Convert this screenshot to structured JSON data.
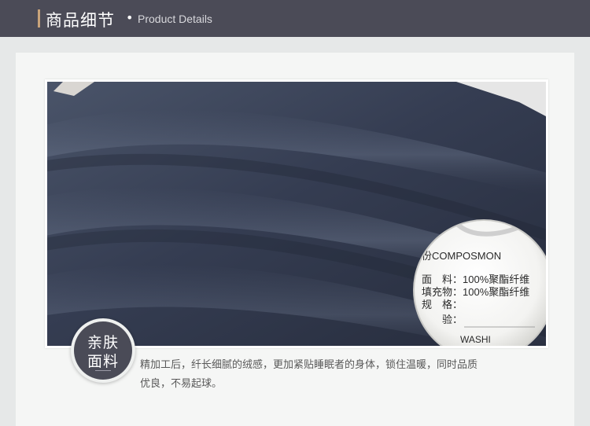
{
  "header": {
    "title_cn": "商品细节",
    "separator": "•",
    "title_en": "Product Details"
  },
  "photo": {
    "label": {
      "line1": "份COMPOSMON",
      "line2": "面　料：100%聚酯纤维",
      "line3": "填充物：100%聚酯纤维",
      "line4": "规　格：",
      "line5": "　　验：",
      "line6": "WASHI"
    }
  },
  "badge": {
    "line1": "亲肤",
    "line2": "面料"
  },
  "description": "精加工后，纤长细腻的绒感，更加紧贴睡眠者的身体，锁住温暖，同时品质优良，不易起球。",
  "colors": {
    "header_bg": "#4b4b57",
    "accent": "#c9a37a",
    "fabric": "#3b4358",
    "badge_bg": "#4a4b57"
  }
}
